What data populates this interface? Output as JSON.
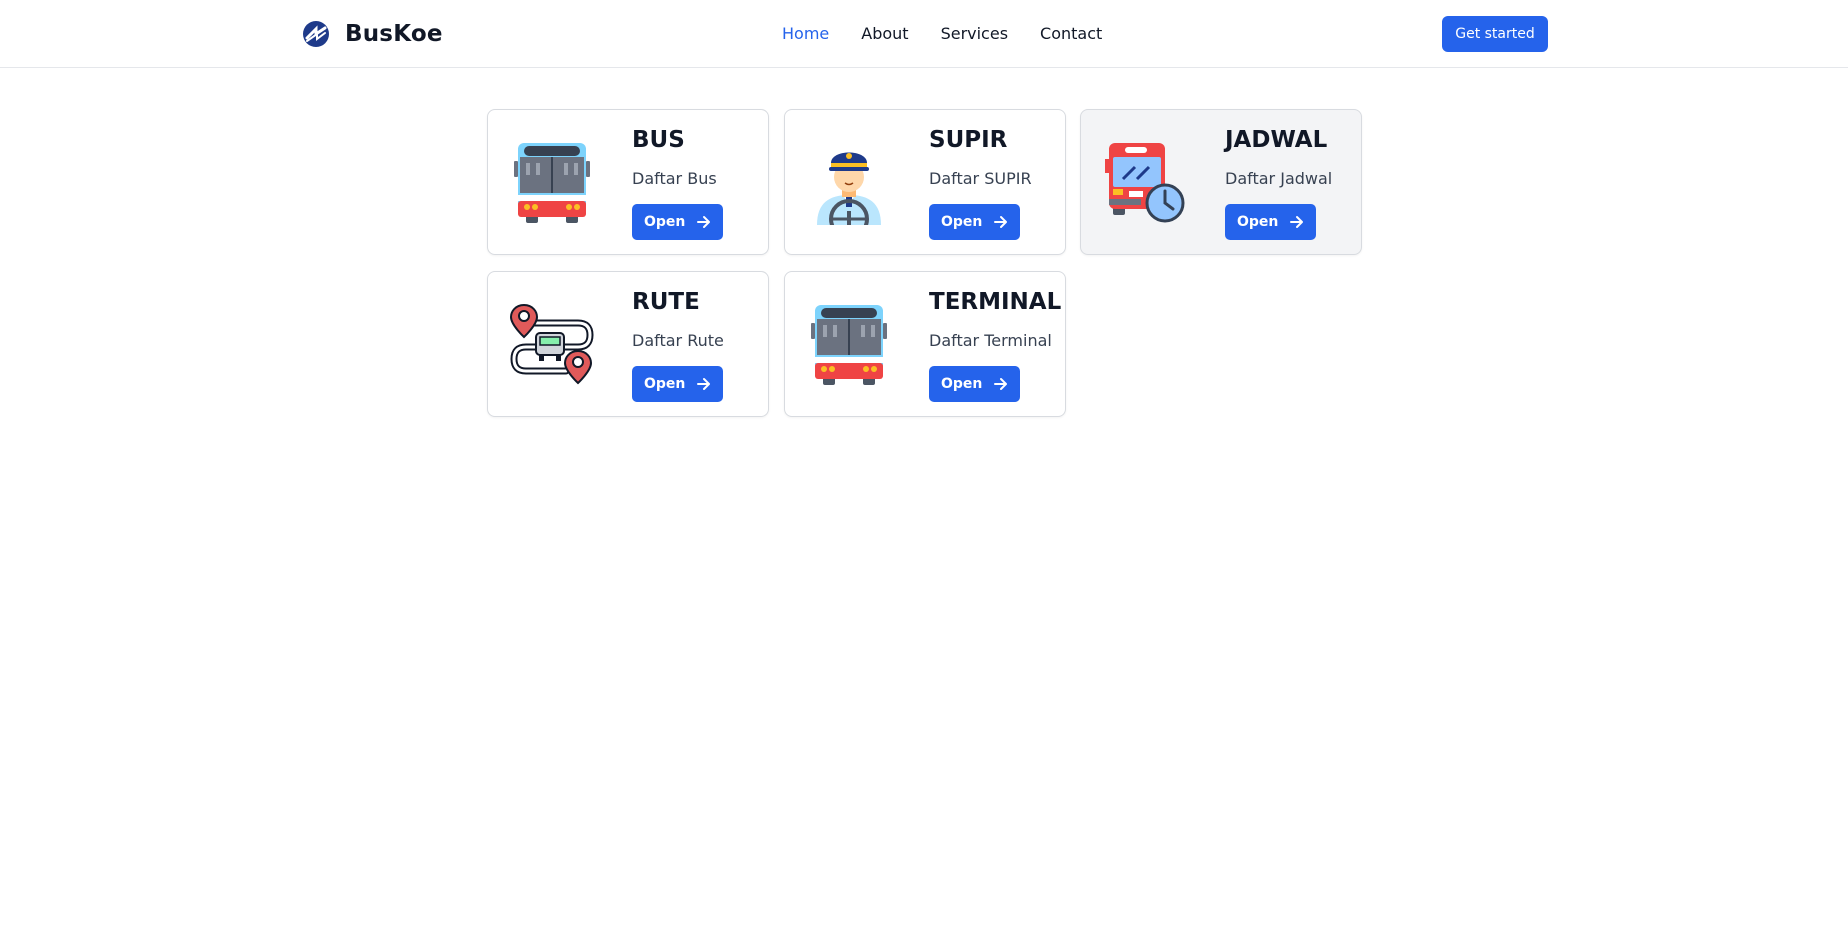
{
  "nav": {
    "brand": "BusKoe",
    "links": [
      {
        "label": "Home",
        "active": true
      },
      {
        "label": "About",
        "active": false
      },
      {
        "label": "Services",
        "active": false
      },
      {
        "label": "Contact",
        "active": false
      }
    ],
    "cta_label": "Get started"
  },
  "colors": {
    "accent": "#2563eb",
    "text": "#111827",
    "muted_text": "#374151",
    "border": "#d8dbe0",
    "hover_bg": "#f3f4f6"
  },
  "cards": [
    {
      "title": "BUS",
      "desc": "Daftar Bus",
      "button": "Open",
      "icon": "bus-icon"
    },
    {
      "title": "SUPIR",
      "desc": "Daftar SUPIR",
      "button": "Open",
      "icon": "driver-icon"
    },
    {
      "title": "JADWAL",
      "desc": "Daftar Jadwal",
      "button": "Open",
      "icon": "bus-schedule-icon"
    },
    {
      "title": "RUTE",
      "desc": "Daftar Rute",
      "button": "Open",
      "icon": "route-icon"
    },
    {
      "title": "TERMINAL",
      "desc": "Daftar Terminal",
      "button": "Open",
      "icon": "terminal-bus-icon"
    }
  ]
}
